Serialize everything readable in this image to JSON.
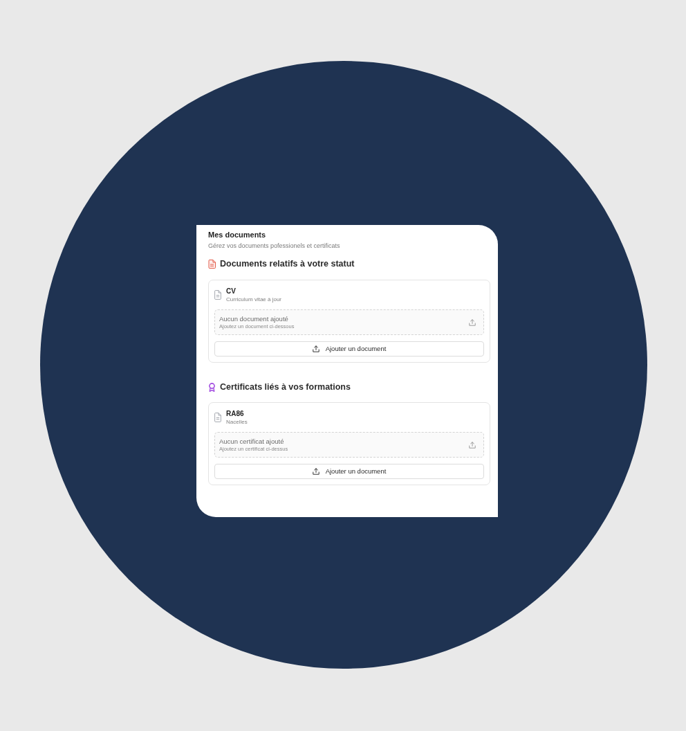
{
  "header": {
    "title": "Mes documents",
    "subtitle": "Gérez vos documents pofessionels et certificats"
  },
  "sections": [
    {
      "kind": "documents",
      "title": "Documents relatifs à votre statut",
      "items": [
        {
          "name": "CV",
          "description": "Curriculum vitae à jour",
          "empty_title": "Aucun document ajouté",
          "empty_hint": "Ajoutez un document ci-dessous",
          "button": "Ajouter un document"
        }
      ]
    },
    {
      "kind": "certificates",
      "title": "Certificats liés à vos formations",
      "items": [
        {
          "name": "RA86",
          "description": "Nacelles",
          "empty_title": "Aucun certificat ajouté",
          "empty_hint": "Ajoutez un certificat ci-dessus",
          "button": "Ajouter un document"
        }
      ]
    }
  ]
}
